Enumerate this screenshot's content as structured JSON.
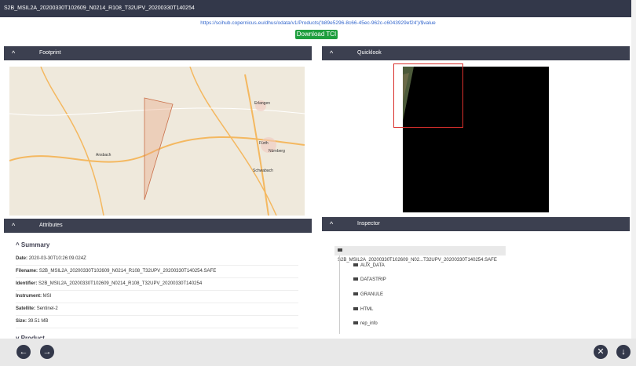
{
  "window": {
    "title": "S2B_MSIL2A_20200330T102609_N0214_R108_T32UPV_20200330T140254"
  },
  "product": {
    "link": "https://scihub.copernicus.eu/dhus/odata/v1/Products('b89e5296-8c66-45ec-962c-c6043929ef24')/$value",
    "download_label": "Download TCI"
  },
  "panels": {
    "footprint": "Footprint",
    "quicklook": "Quicklook",
    "attributes": "Attributes",
    "inspector": "Inspector"
  },
  "summary": {
    "heading": "Summary",
    "date_label": "Date:",
    "date_value": "2020-03-30T10:26:09.024Z",
    "filename_label": "Filename:",
    "filename_value": "S2B_MSIL2A_20200330T102609_N0214_R108_T32UPV_20200330T140254.SAFE",
    "identifier_label": "Identifier:",
    "identifier_value": "S2B_MSIL2A_20200330T102609_N0214_R108_T32UPV_20200330T140254",
    "instrument_label": "Instrument:",
    "instrument_value": "MSI",
    "satellite_label": "Satellite:",
    "satellite_value": "Sentinel-2",
    "size_label": "Size:",
    "size_value": "39.51 MB",
    "product_heading": "Product"
  },
  "inspector": {
    "root": "S2B_MSIL2A_20200330T102609_N02...T32UPV_20200330T140254.SAFE",
    "items": [
      "AUX_DATA",
      "DATASTRIP",
      "GRANULE",
      "HTML",
      "rep_info"
    ]
  },
  "map_labels": [
    "Erlangen",
    "Fürth",
    "Nürnberg",
    "Schwabach",
    "Ansbach"
  ],
  "colors": {
    "accent": "#1e9e3e",
    "header": "#33384a",
    "highlight": "#d9302c"
  }
}
